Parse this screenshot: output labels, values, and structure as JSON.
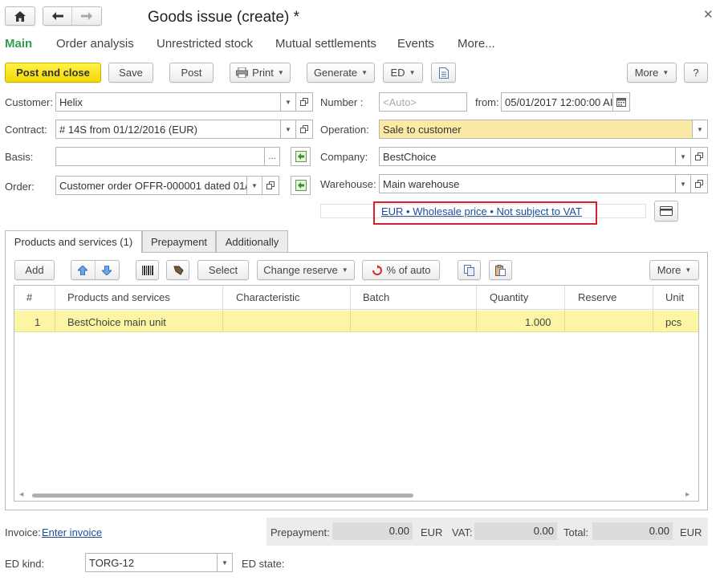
{
  "window": {
    "title": "Goods issue (create) *"
  },
  "nav_tabs": [
    "Main",
    "Order analysis",
    "Unrestricted stock",
    "Mutual settlements",
    "Events",
    "More..."
  ],
  "toolbar": {
    "post_close": "Post and close",
    "save": "Save",
    "post": "Post",
    "print": "Print",
    "generate": "Generate",
    "ed": "ED",
    "more": "More",
    "help": "?"
  },
  "form": {
    "customer_label": "Customer:",
    "customer_value": "Helix",
    "contract_label": "Contract:",
    "contract_value": "# 14S from 01/12/2016 (EUR)",
    "basis_label": "Basis:",
    "basis_value": "",
    "basis_button": "...",
    "order_label": "Order:",
    "order_value": "Customer order OFFR-000001 dated 01/",
    "number_label": "Number :",
    "number_placeholder": "<Auto>",
    "from_label": "from:",
    "from_value": "05/01/2017 12:00:00 AI",
    "operation_label": "Operation:",
    "operation_value": "Sale to customer",
    "company_label": "Company:",
    "company_value": "BestChoice",
    "warehouse_label": "Warehouse:",
    "warehouse_value": "Main warehouse",
    "price_link": "EUR • Wholesale price • Not subject to VAT"
  },
  "doc_tabs": [
    "Products and services (1)",
    "Prepayment",
    "Additionally"
  ],
  "table_toolbar": {
    "add": "Add",
    "select": "Select",
    "change_reserve": "Change reserve",
    "pct_auto": "% of auto",
    "more": "More"
  },
  "table": {
    "columns": [
      "#",
      "Products and services",
      "Characteristic",
      "Batch",
      "Quantity",
      "Reserve",
      "Unit"
    ],
    "rows": [
      {
        "num": "1",
        "product": "BestChoice main unit",
        "characteristic": "",
        "batch": "",
        "quantity": "1.000",
        "reserve": "",
        "unit": "pcs"
      }
    ]
  },
  "footer": {
    "invoice_label": "Invoice:",
    "invoice_link": "Enter invoice",
    "prepayment_label": "Prepayment:",
    "prepayment_value": "0.00",
    "prepayment_currency": "EUR",
    "vat_label": "VAT:",
    "vat_value": "0.00",
    "total_label": "Total:",
    "total_value": "0.00",
    "total_currency": "EUR",
    "ed_kind_label": "ED kind:",
    "ed_kind_value": "TORG-12",
    "ed_state_label": "ED state:"
  },
  "colors": {
    "primary_button": "#f5dd0a",
    "active_tab": "#2f9e4a",
    "selected_row": "#fbf5a4",
    "operation_field": "#fbeaa6",
    "highlight_box": "#d8202a",
    "link": "#1b4f9c"
  }
}
